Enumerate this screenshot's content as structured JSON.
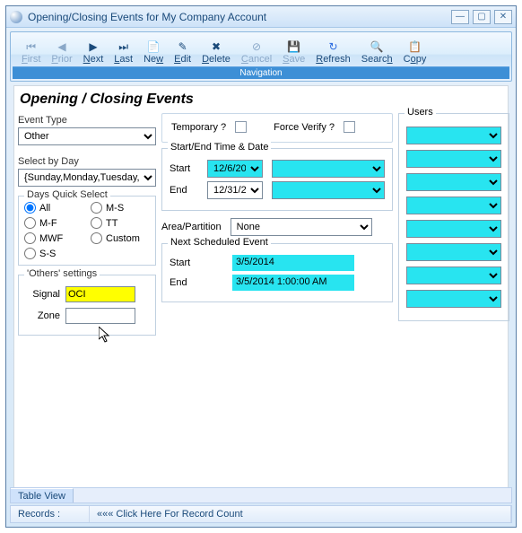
{
  "window": {
    "title": "Opening/Closing Events for My Company Account"
  },
  "toolbar": {
    "first": "First",
    "prior": "Prior",
    "next": "Next",
    "last": "Last",
    "new": "New",
    "edit": "Edit",
    "delete": "Delete",
    "cancel": "Cancel",
    "save": "Save",
    "refresh": "Refresh",
    "search": "Search",
    "copy": "Copy",
    "navlabel": "Navigation"
  },
  "header": "Opening / Closing Events",
  "event_type": {
    "label": "Event Type",
    "value": "Other"
  },
  "select_by_day": {
    "label": "Select by Day",
    "value": "{Sunday,Monday,Tuesday,W"
  },
  "days_quick": {
    "legend": "Days Quick Select",
    "options": [
      "All",
      "M-F",
      "MWF",
      "S-S",
      "M-S",
      "TT",
      "Custom"
    ],
    "selected": "All"
  },
  "others": {
    "legend": "'Others' settings",
    "signal_label": "Signal",
    "signal_value": "OCI",
    "zone_label": "Zone",
    "zone_value": ""
  },
  "flags": {
    "temporary_label": "Temporary ?",
    "force_verify_label": "Force Verify ?"
  },
  "startend": {
    "legend": "Start/End Time & Date",
    "start_label": "Start",
    "end_label": "End",
    "start_date": "12/6/20",
    "end_date": "12/31/2"
  },
  "area": {
    "label": "Area/Partition",
    "value": "None"
  },
  "nse": {
    "legend": "Next Scheduled Event",
    "start_label": "Start",
    "end_label": "End",
    "start_value": "3/5/2014",
    "end_value": "3/5/2014 1:00:00 AM"
  },
  "users": {
    "legend": "Users"
  },
  "tab": "Table View",
  "status": {
    "records_label": "Records :",
    "count_hint": "««« Click Here For Record Count"
  }
}
